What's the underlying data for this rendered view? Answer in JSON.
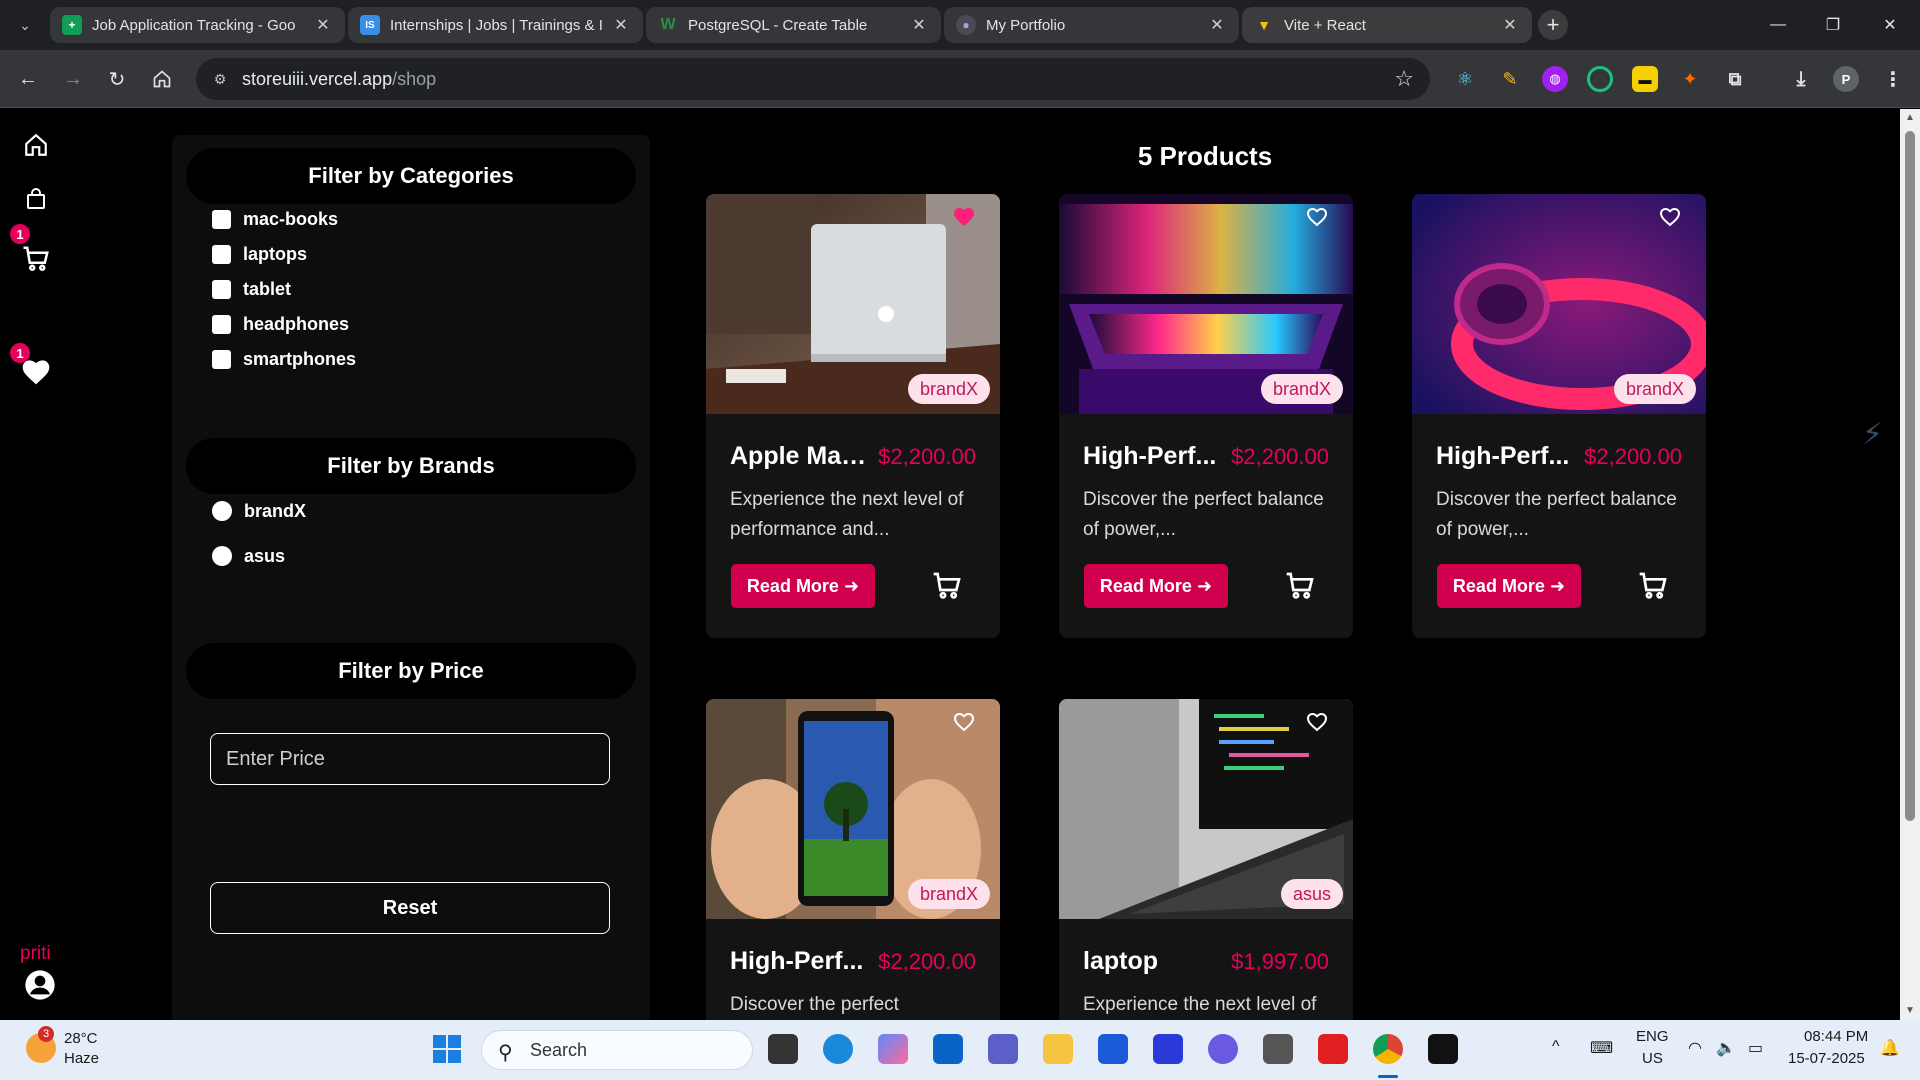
{
  "browser": {
    "tabs": [
      {
        "title": "Job Application Tracking - Goo",
        "favicon": "sheets-icon",
        "color": "#0f9d58",
        "glyph": "+"
      },
      {
        "title": "Internships | Jobs | Trainings & I",
        "favicon": "internshala-icon",
        "color": "#3a8ee6",
        "glyph": "IS"
      },
      {
        "title": "PostgreSQL - Create Table",
        "favicon": "w3-icon",
        "color": "#2f8d46",
        "glyph": "W"
      },
      {
        "title": "My Portfolio",
        "favicon": "portfolio-icon",
        "color": "#7b61ff",
        "glyph": "●"
      },
      {
        "title": "Vite + React",
        "favicon": "vite-icon",
        "color": "#f5c400",
        "glyph": "▼"
      }
    ],
    "active_tab": 4,
    "url_host": "storeuiii.vercel.app",
    "url_path": "/shop",
    "profile_initial": "P"
  },
  "sidebar": {
    "cart_count": "1",
    "wishlist_count": "1",
    "user_name": "priti"
  },
  "filters": {
    "categories_heading": "Filter by Categories",
    "categories": [
      "mac-books",
      "laptops",
      "tablet",
      "headphones",
      "smartphones"
    ],
    "brands_heading": "Filter by Brands",
    "brands": [
      "brandX",
      "asus"
    ],
    "price_heading": "Filter by Price",
    "price_placeholder": "Enter Price",
    "reset_label": "Reset"
  },
  "products": {
    "count_label": "5 Products",
    "read_more_label": "Read More",
    "items": [
      {
        "name": "Apple Mac...",
        "price": "$2,200.00",
        "brand": "brandX",
        "description": "Experience the next level of performance and...",
        "wishlisted": true,
        "image": "macbook"
      },
      {
        "name": "High-Perf...",
        "price": "$2,200.00",
        "brand": "brandX",
        "description": "Discover the perfect balance of power,...",
        "wishlisted": false,
        "image": "laptop-rgb"
      },
      {
        "name": "High-Perf...",
        "price": "$2,200.00",
        "brand": "brandX",
        "description": "Discover the perfect balance of power,...",
        "wishlisted": false,
        "image": "headphones"
      },
      {
        "name": "High-Perf...",
        "price": "$2,200.00",
        "brand": "brandX",
        "description": "Discover the perfect",
        "wishlisted": false,
        "image": "smartphone"
      },
      {
        "name": "laptop",
        "price": "$1,997.00",
        "brand": "asus",
        "description": "Experience the next level of",
        "wishlisted": false,
        "image": "laptop-code"
      }
    ]
  },
  "taskbar": {
    "weather_temp": "28°C",
    "weather_desc": "Haze",
    "weather_badge": "3",
    "search_label": "Search",
    "lang_line1": "ENG",
    "lang_line2": "US",
    "time": "08:44 PM",
    "date": "15-07-2025"
  },
  "colors": {
    "accent": "#e6005c",
    "button": "#d1004f",
    "brand_pill_bg": "#fde2ec",
    "card_bg": "#141414"
  }
}
